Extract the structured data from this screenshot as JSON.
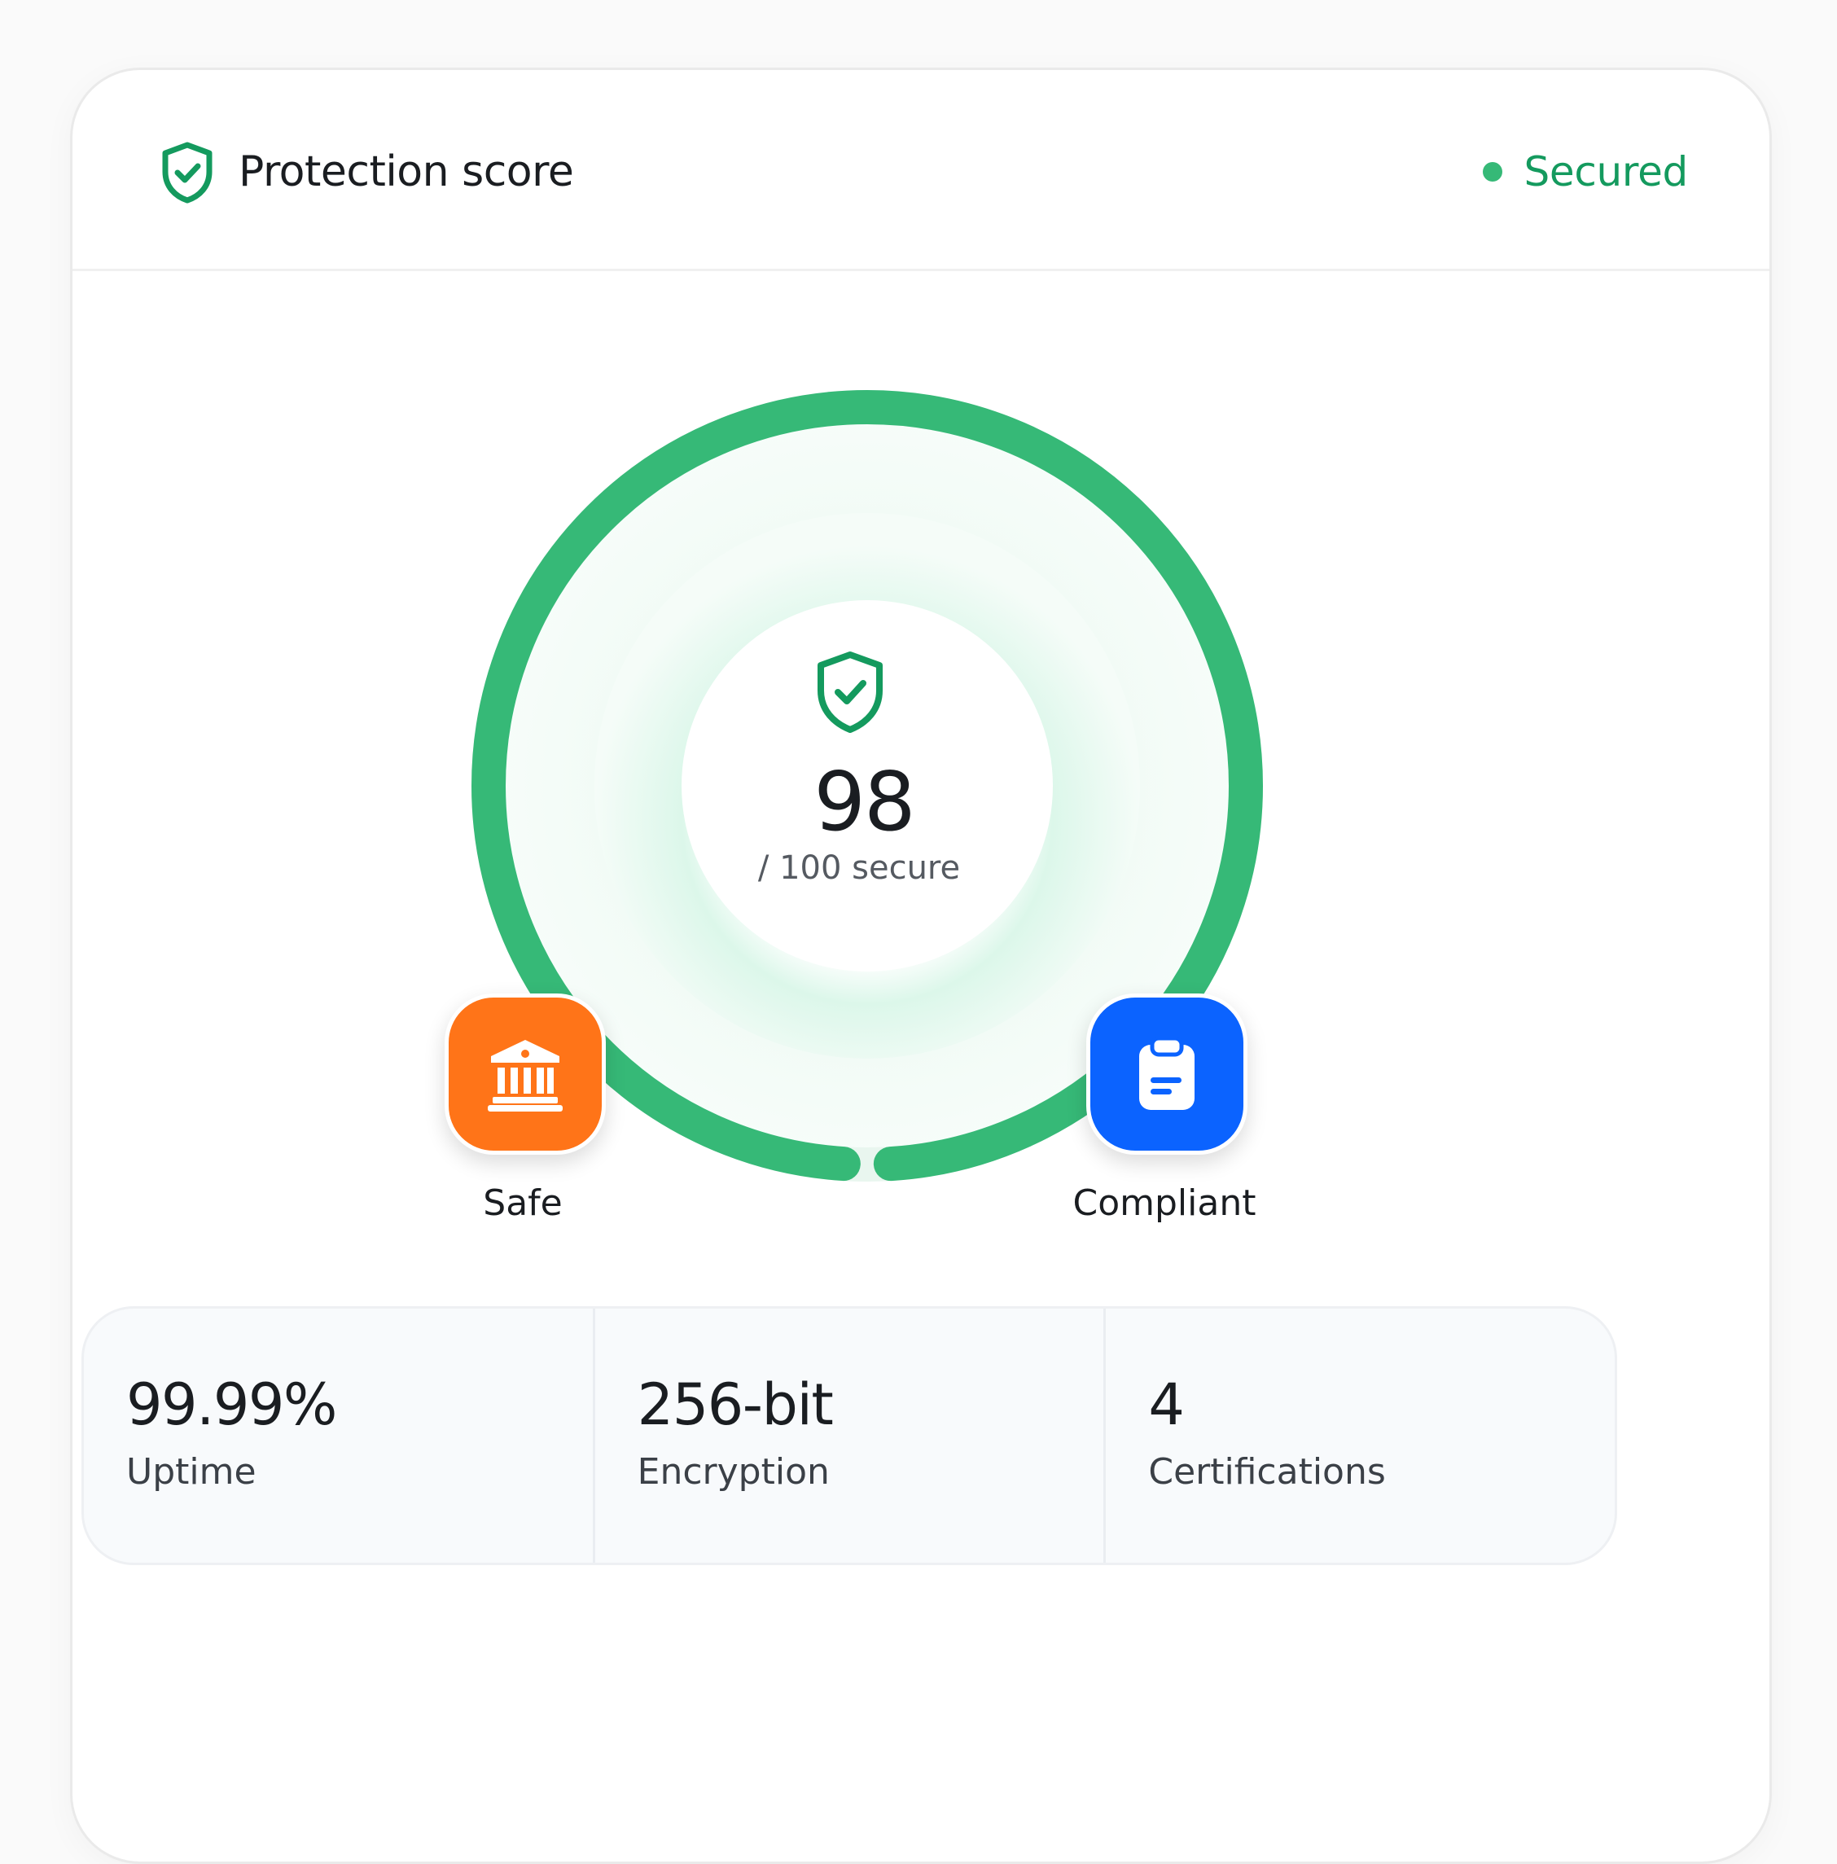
{
  "header": {
    "title": "Protection score",
    "icon": "shield-check-icon",
    "status_label": "Secured",
    "status_color": "#36b977"
  },
  "score": {
    "value": "98",
    "subtitle": "/ 100 secure",
    "fraction": 0.98,
    "ring_color": "#36b977",
    "icon": "shield-check-icon"
  },
  "badges": [
    {
      "label": "Safe",
      "icon": "bank-icon",
      "color": "#ff7418"
    },
    {
      "label": "Compliant",
      "icon": "clipboard-icon",
      "color": "#0b63ff"
    }
  ],
  "stats": [
    {
      "value": "99.99%",
      "label": "Uptime"
    },
    {
      "value": "256-bit",
      "label": "Encryption"
    },
    {
      "value": "4",
      "label": "Certifications"
    }
  ]
}
